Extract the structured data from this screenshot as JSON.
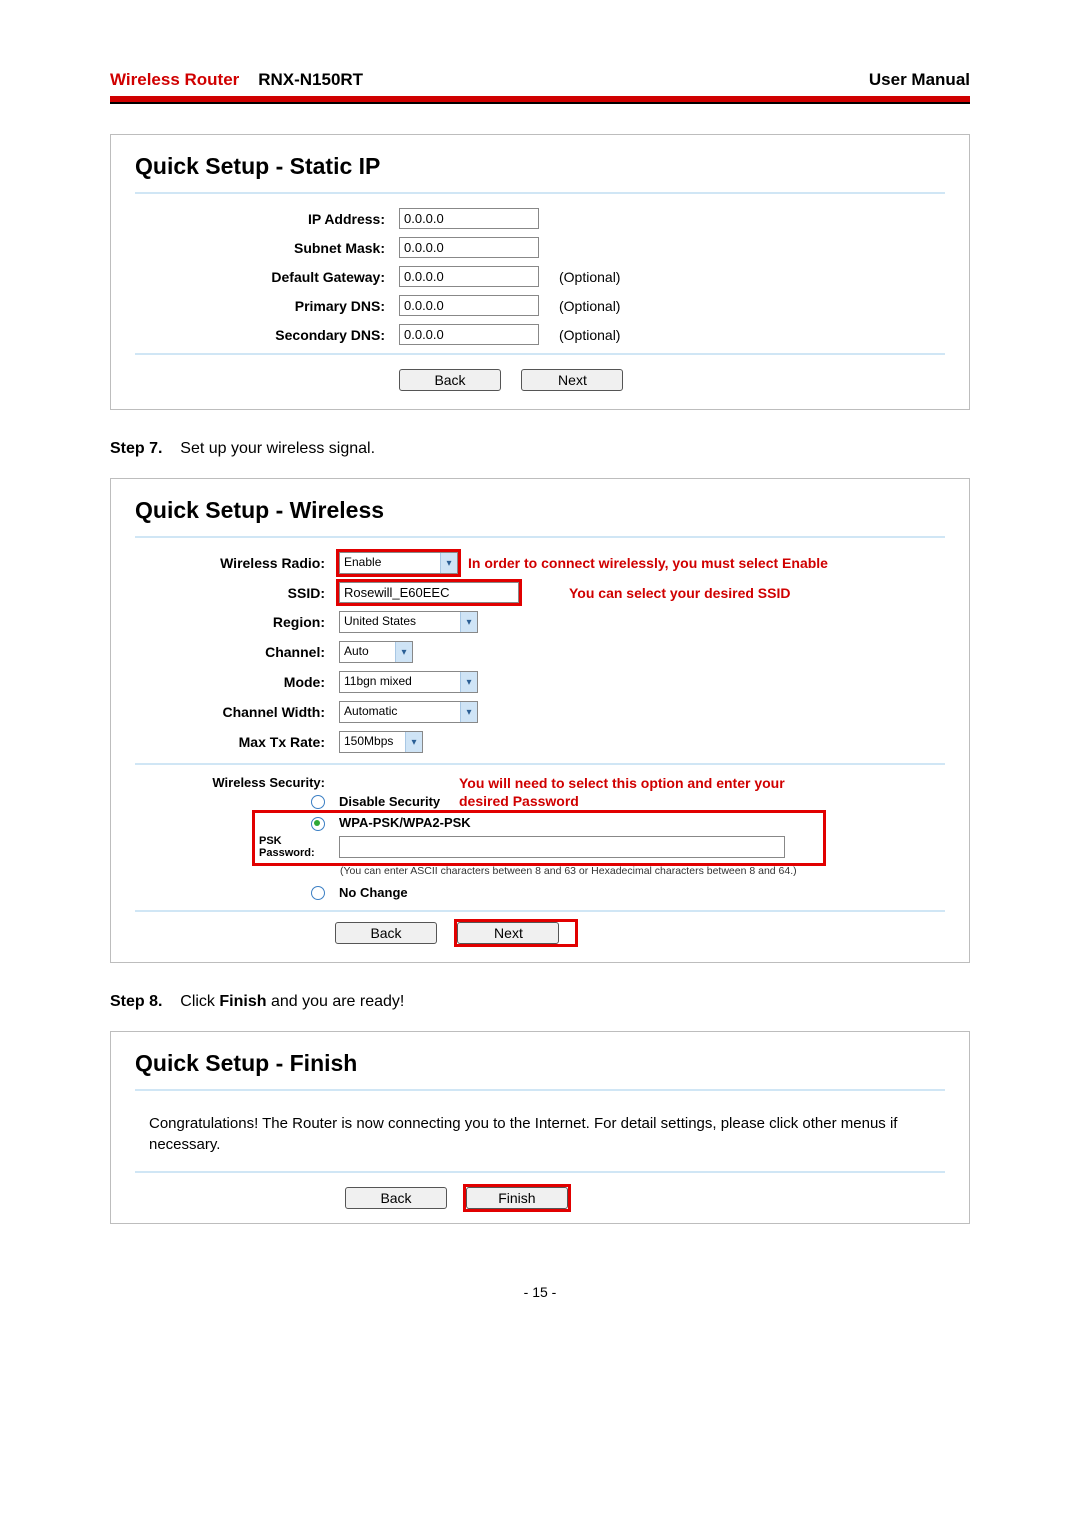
{
  "header": {
    "brand": "Wireless Router",
    "model": "RNX-N150RT",
    "manual": "User Manual"
  },
  "panel_static": {
    "title": "Quick Setup - Static IP",
    "rows": {
      "ip": {
        "label": "IP Address:",
        "value": "0.0.0.0",
        "aux": ""
      },
      "mask": {
        "label": "Subnet Mask:",
        "value": "0.0.0.0",
        "aux": ""
      },
      "gateway": {
        "label": "Default Gateway:",
        "value": "0.0.0.0",
        "aux": "(Optional)"
      },
      "dns1": {
        "label": "Primary DNS:",
        "value": "0.0.0.0",
        "aux": "(Optional)"
      },
      "dns2": {
        "label": "Secondary DNS:",
        "value": "0.0.0.0",
        "aux": "(Optional)"
      }
    },
    "back": "Back",
    "next": "Next"
  },
  "step7": {
    "label": "Step 7.",
    "text": "Set up your wireless signal."
  },
  "panel_wireless": {
    "title": "Quick Setup - Wireless",
    "radio_label": "Wireless Radio:",
    "radio_value": "Enable",
    "radio_annot": "In order to connect wirelessly, you must select Enable",
    "ssid_label": "SSID:",
    "ssid_value": "Rosewill_E60EEC",
    "ssid_annot": "You can select your desired SSID",
    "region_label": "Region:",
    "region_value": "United States",
    "channel_label": "Channel:",
    "channel_value": "Auto",
    "mode_label": "Mode:",
    "mode_value": "11bgn mixed",
    "cwidth_label": "Channel Width:",
    "cwidth_value": "Automatic",
    "txrate_label": "Max Tx Rate:",
    "txrate_value": "150Mbps",
    "sec_label": "Wireless Security:",
    "opt_disable": "Disable Security",
    "opt_wpa": "WPA-PSK/WPA2-PSK",
    "psk_label": "PSK Password:",
    "psk_value": "",
    "psk_note": "(You can enter ASCII characters between 8 and 63 or Hexadecimal characters between 8 and 64.)",
    "opt_nochange": "No Change",
    "sec_annot1": "You will need to select this option and enter your",
    "sec_annot2": "desired Password",
    "back": "Back",
    "next": "Next"
  },
  "step8": {
    "label": "Step 8.",
    "text_prefix": "Click ",
    "text_bold": "Finish",
    "text_suffix": " and you are ready!"
  },
  "panel_finish": {
    "title": "Quick Setup - Finish",
    "body": "Congratulations! The Router is now connecting you to the Internet. For detail settings, please click other menus if necessary.",
    "back": "Back",
    "finish": "Finish"
  },
  "page_number": "- 15 -"
}
